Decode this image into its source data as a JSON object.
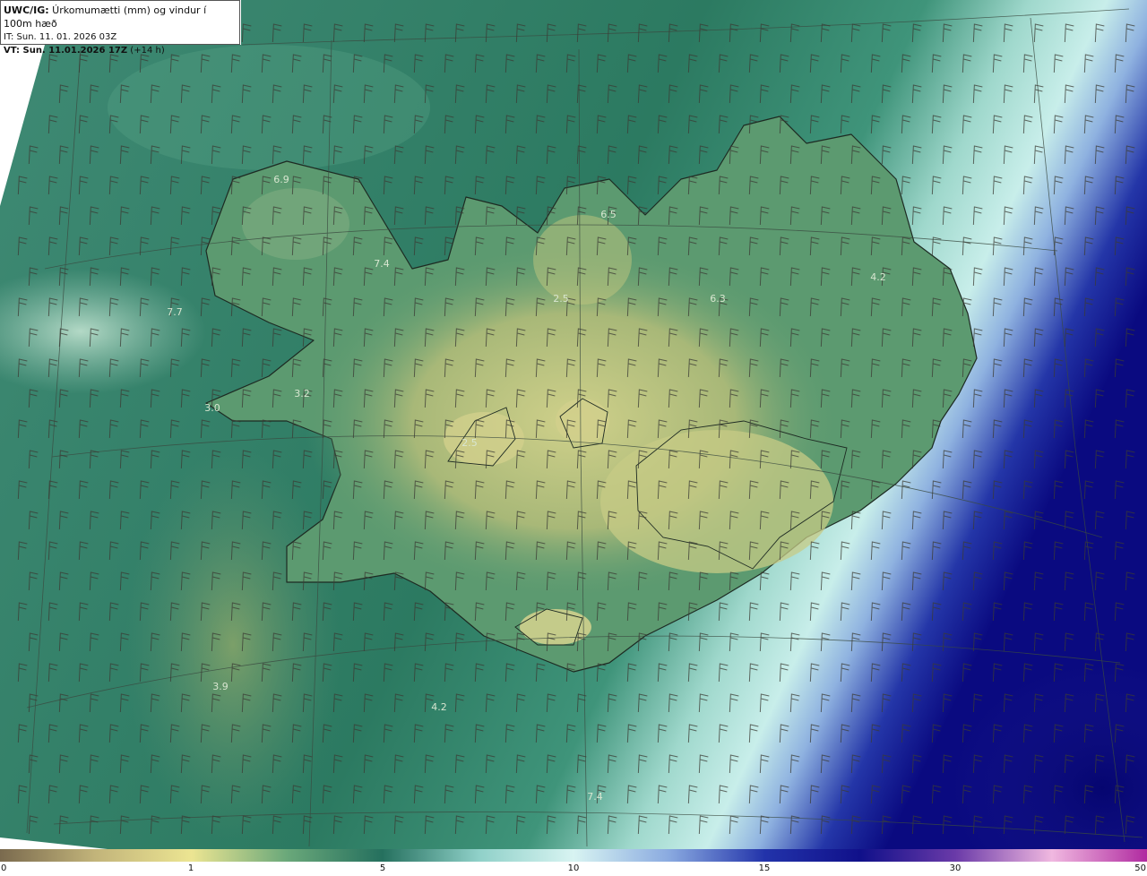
{
  "header": {
    "model": "UWC/IG:",
    "title": " Úrkomumætti (mm) og vindur í 100m hæð",
    "it_line": "IT: Sun. 11. 01. 2026 03Z",
    "vt_bold": "VT: Sun. 11.01.2026 17Z",
    "vt_suffix": " (+14 h)"
  },
  "map_labels": [
    "6.9",
    "6.5",
    "7.4",
    "7.7",
    "2.5",
    "6.3",
    "4.2",
    "3.2",
    "3.0",
    "2.5",
    "3.9",
    "4.2",
    "7.4"
  ],
  "colorbar": {
    "ticks": [
      "0",
      "1",
      "5",
      "10",
      "15",
      "30",
      "50"
    ],
    "colors": [
      "#7a6a4e",
      "#c2b47a",
      "#ece592",
      "#6aa87a",
      "#25705e",
      "#8fd0c8",
      "#d8f4f2",
      "#8aaae0",
      "#2233aa",
      "#10108a",
      "#6a3aa8",
      "#f0b8e0",
      "#b02aa0"
    ]
  },
  "colors": {
    "sea_dark": "#2e7a62",
    "land_yellow": "#c7cb86",
    "heavy_blue": "#0b0b80"
  }
}
